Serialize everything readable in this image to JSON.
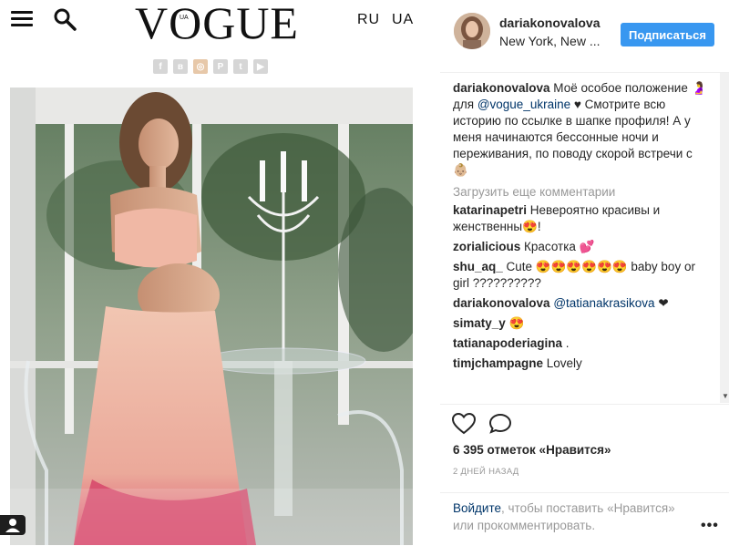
{
  "site": {
    "logo_text": "VOGUE",
    "logo_edition": "UA",
    "languages": [
      "RU",
      "UA"
    ],
    "social_icons": [
      "facebook-icon",
      "vk-icon",
      "instagram-icon",
      "pinterest-icon",
      "twitter-icon",
      "youtube-icon"
    ]
  },
  "post": {
    "username": "dariakonovalova",
    "location": "New York, New ...",
    "follow_label": "Подписаться",
    "caption": {
      "username": "dariakonovalova",
      "text_before": " Моё особое положение 🤰 для ",
      "mention": "@vogue_ukraine",
      "text_after": " ♥ Смотрите всю историю по ссылке в шапке профиля! А у меня начинаются бессонные ночи и переживания, по поводу скорой встречи с 👶🏼"
    },
    "load_more_label": "Загрузить еще комментарии",
    "comments": [
      {
        "user": "katarinapetri",
        "text": " Невероятно красивы и женственны😍!"
      },
      {
        "user": "zorialicious",
        "text": " Красотка 💕"
      },
      {
        "user": "shu_aq_",
        "text": " Cute 😍😍😍😍😍😍 baby boy or girl ??????????"
      },
      {
        "user": "dariakonovalova",
        "mention": "@tatianakrasikova",
        "text": " ❤"
      },
      {
        "user": "simaty_y",
        "text": " 😍"
      },
      {
        "user": "tatianapoderiagina",
        "text": " ."
      },
      {
        "user": "timjchampagne",
        "text": " Lovely"
      }
    ],
    "likes": "6 395 отметок «Нравится»",
    "time": "2 ДНЕЙ НАЗАД",
    "login_link": "Войдите",
    "login_rest": ", чтобы поставить «Нравится» или прокомментировать.",
    "more_label": "•••"
  }
}
